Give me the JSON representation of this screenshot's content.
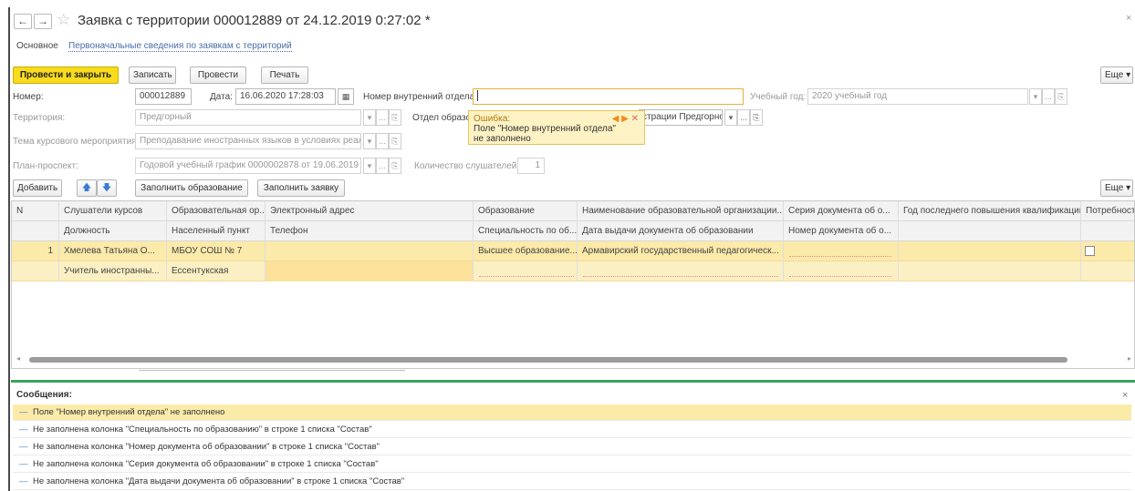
{
  "window": {
    "back_glyph": "←",
    "forward_glyph": "→",
    "star_glyph": "☆",
    "title": "Заявка с территории 000012889 от 24.12.2019 0:27:02 *",
    "close_glyph": "×"
  },
  "tabs": [
    {
      "label": "Основное"
    },
    {
      "label": "Первоначальные сведения по заявкам с территорий"
    }
  ],
  "toolbar": {
    "post_close": "Провести и закрыть",
    "save": "Записать",
    "post": "Провести",
    "print": "Печать",
    "more": "Еще ▾"
  },
  "form": {
    "number_label": "Номер:",
    "number_value": "000012889",
    "date_label": "Дата:",
    "date_value": "16.06.2020 17:28:03",
    "calendar_glyph": "▦",
    "internal_number_label": "Номер внутренний отдела:",
    "internal_number_value": "",
    "school_year_label": "Учебный год:",
    "school_year_value": "2020 учебный год",
    "territory_label": "Территория:",
    "territory_value": "Предгорный",
    "department_label": "Отдел образо",
    "department_value": "страции Предгорног",
    "course_topic_label": "Тема курсового мероприятия:",
    "course_topic_value": "Преподавание иностранных языков в условиях реали",
    "plan_label": "План-проспект:",
    "plan_value": "Годовой учебный график 0000002878 от 19.06.2019 1(",
    "listeners_count_label": "Количество слушателей:",
    "listeners_count_value": "1",
    "dropdown_glyph": "▾",
    "ellipsis_glyph": "...",
    "link_glyph": "⎘"
  },
  "error_tooltip": {
    "title": "Ошибка:",
    "line1": "Поле \"Номер внутренний отдела\"",
    "line2": "не заполнено",
    "nav_prev": "◀",
    "nav_next": "▶",
    "nav_close": "✕"
  },
  "table_toolbar": {
    "add": "Добавить",
    "up": "🡅",
    "down": "🡇",
    "fill_education": "Заполнить образование",
    "fill_request": "Заполнить заявку",
    "more": "Еще ▾"
  },
  "table": {
    "header_row1": [
      "N",
      "Слушатели курсов",
      "Образовательная ор...",
      "Электронный адрес",
      "Образование",
      "Наименование образовательной организации...",
      "Серия документа об о...",
      "Год последнего повышения квалификации",
      "Потребност"
    ],
    "header_row2": [
      "",
      "Должность",
      "Населенный пункт",
      "Телефон",
      "Специальность по об...",
      "Дата выдачи документа об образовании",
      "Номер документа об о...",
      "",
      ""
    ],
    "rows": [
      {
        "line1": [
          "1",
          "Хмелева Татьяна О...",
          "МБОУ СОШ № 7",
          "",
          "Высшее образование...",
          "Армавирский государственный педагогическ...",
          "",
          "",
          ""
        ],
        "line2": [
          "",
          "Учитель иностранны...",
          "Ессентукская",
          "",
          "",
          "",
          "",
          "",
          ""
        ]
      }
    ]
  },
  "scrollbar": {
    "left_arrow": "◂",
    "right_arrow": "▸"
  },
  "messages": {
    "title": "Сообщения:",
    "close_glyph": "×",
    "dash": "—",
    "items": [
      "Поле \"Номер внутренний отдела\" не заполнено",
      "Не заполнена колонка \"Специальность по образованию\" в строке 1 списка \"Состав\"",
      "Не заполнена колонка \"Номер документа об образовании\" в строке 1 списка \"Состав\"",
      "Не заполнена колонка \"Серия документа об образовании\" в строке 1 списка \"Состав\"",
      "Не заполнена колонка \"Дата выдачи документа об образовании\" в строке 1 списка \"Состав\""
    ]
  },
  "colors": {
    "primary_button": "#f8dc1c",
    "selected_row": "#fbeaa9",
    "error_tooltip_bg": "#fdf2c4",
    "messages_bar": "#38a45a",
    "link": "#4a6ca8"
  }
}
